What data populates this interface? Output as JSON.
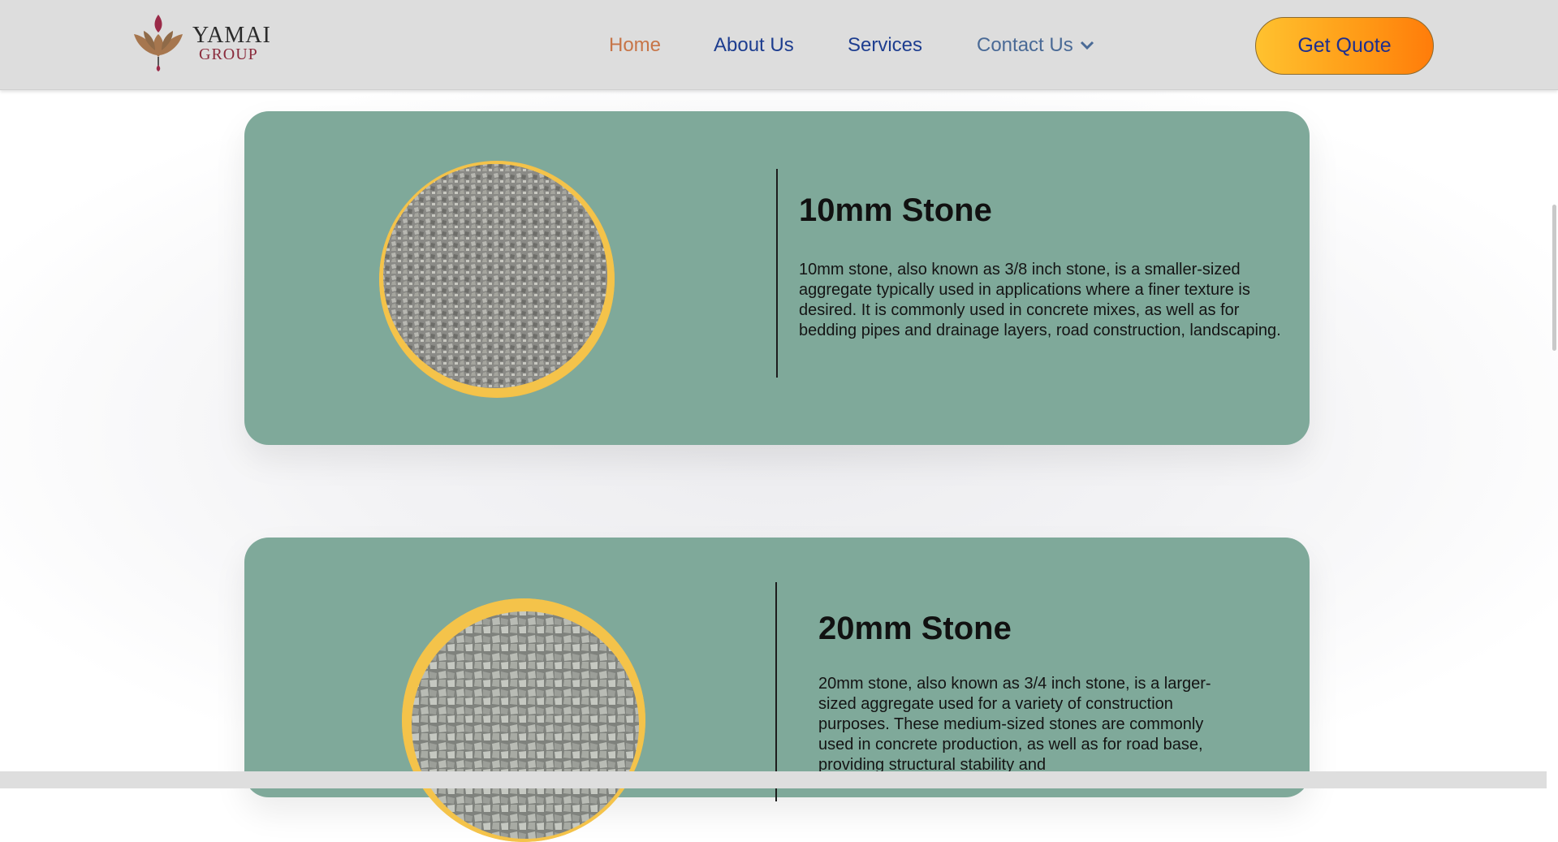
{
  "brand": {
    "name": "YAMAI",
    "sub": "GROUP"
  },
  "nav": {
    "home": "Home",
    "about": "About Us",
    "services": "Services",
    "contact": "Contact Us"
  },
  "cta": {
    "label": "Get Quote"
  },
  "colors": {
    "header_bg": "#dddddd",
    "card_bg": "#7fa99a",
    "nav_active": "#c77548",
    "nav_link": "#1d3d8f",
    "cta_gradient_start": "#ffc22f",
    "cta_gradient_end": "#ff7c0a"
  },
  "products": [
    {
      "title": "10mm Stone",
      "description": "10mm stone, also known as 3/8 inch stone, is a smaller-sized aggregate typically used in applications where a finer texture is desired. It is commonly used in concrete mixes, as well as for bedding pipes and drainage layers, road construction, landscaping.",
      "image_icon": "gravel-bowl-image"
    },
    {
      "title": "20mm Stone",
      "description": "20mm stone, also known as 3/4 inch stone, is a larger-sized aggregate used for a variety of construction purposes. These medium-sized stones are commonly used in concrete production, as well as for road base, providing structural stability and",
      "image_icon": "gravel-bowl-image"
    }
  ]
}
